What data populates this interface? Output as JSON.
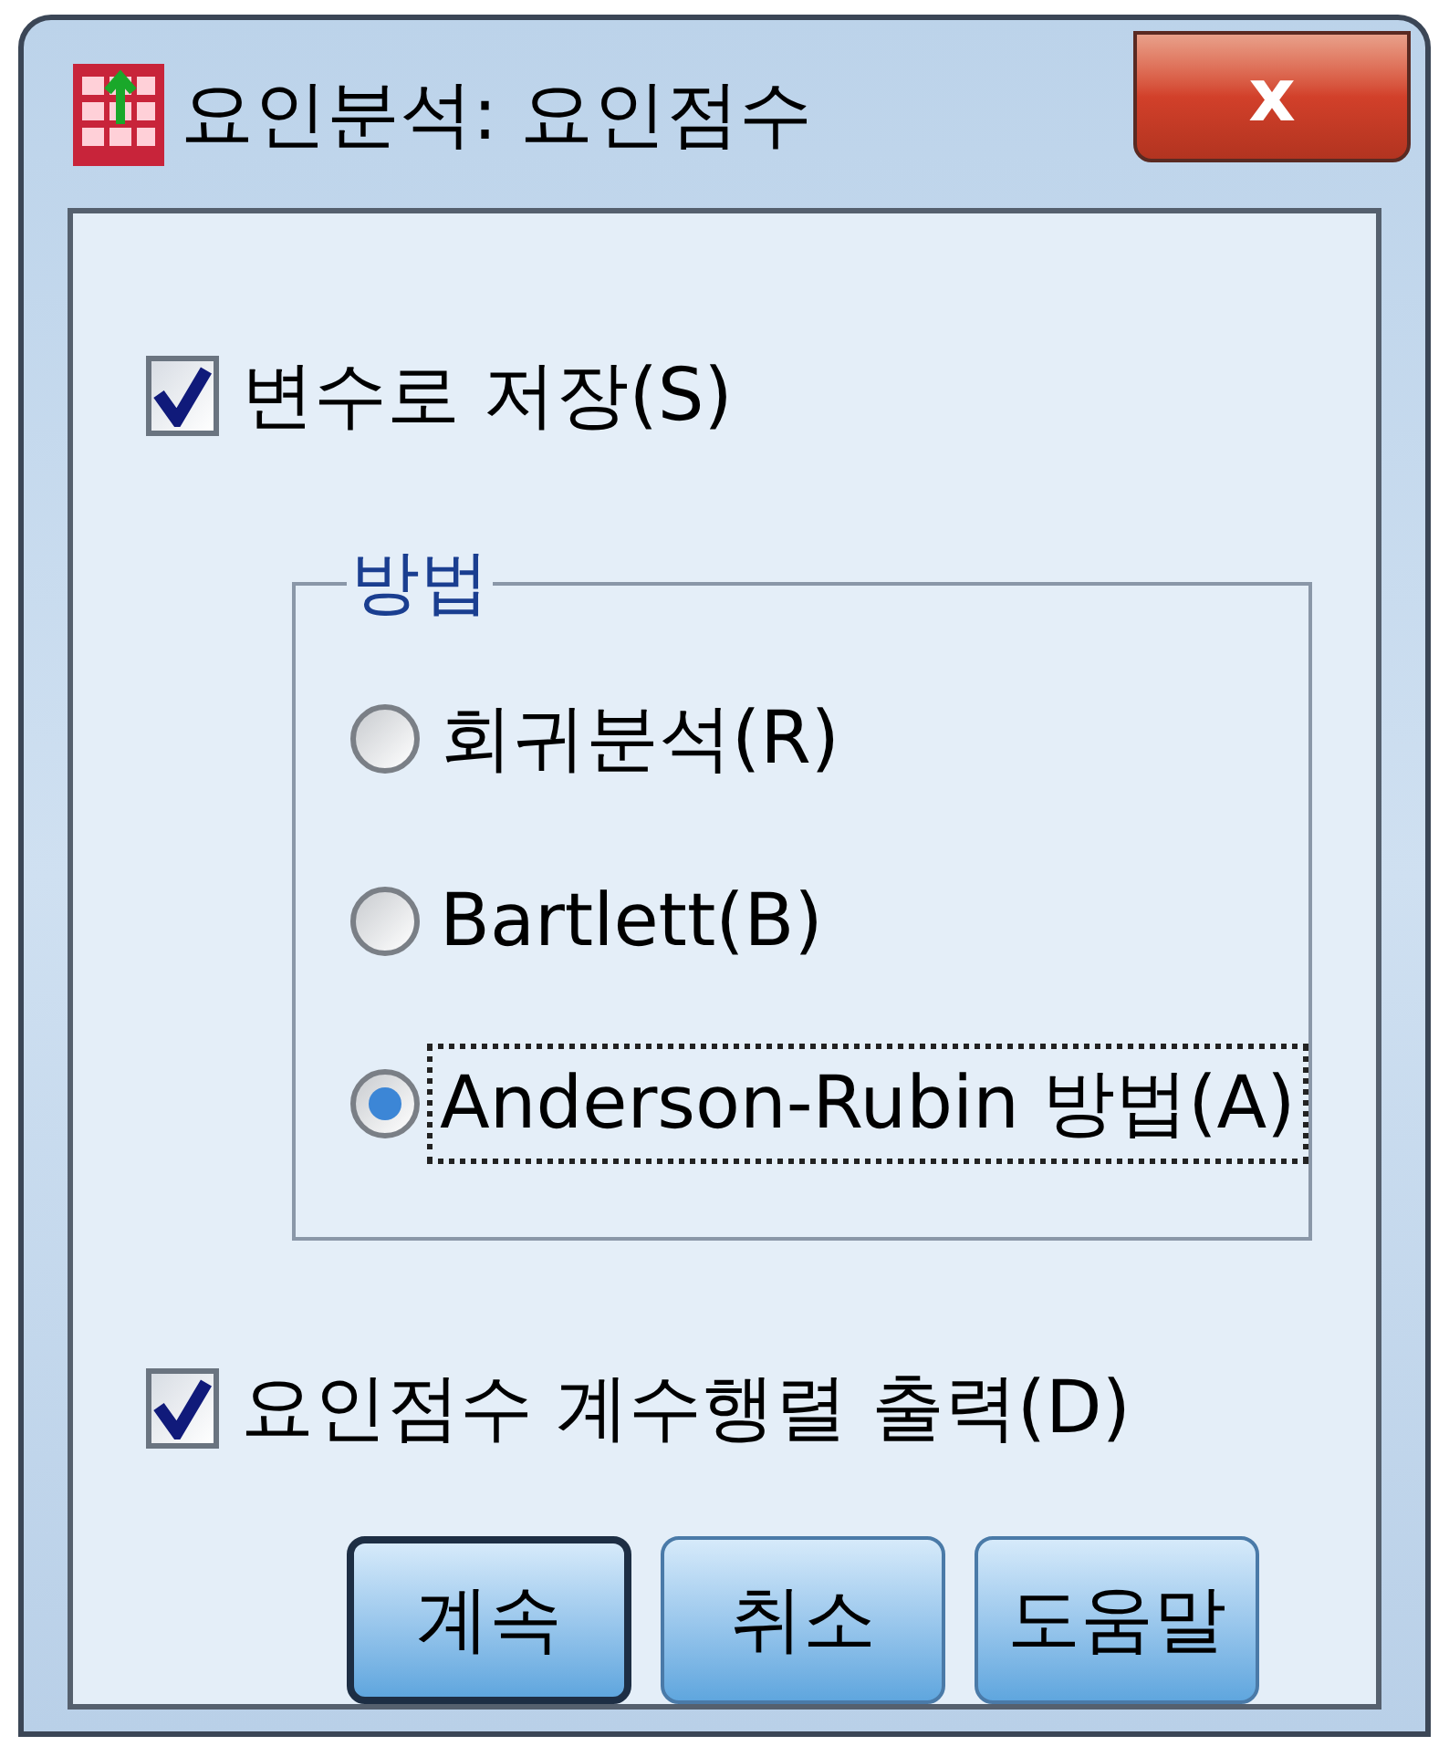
{
  "window": {
    "title": "요인분석: 요인점수",
    "close_label": "x"
  },
  "save_as_variables": {
    "label": "변수로 저장(S)",
    "checked": true
  },
  "method": {
    "legend": "방법",
    "options": [
      {
        "label": "회귀분석(R)",
        "selected": false,
        "focused": false
      },
      {
        "label": "Bartlett(B)",
        "selected": false,
        "focused": false
      },
      {
        "label": "Anderson-Rubin 방법(A)",
        "selected": true,
        "focused": true
      }
    ]
  },
  "display_matrix": {
    "label": "요인점수 계수행렬 출력(D)",
    "checked": true
  },
  "buttons": [
    {
      "label": "계속",
      "default": true
    },
    {
      "label": "취소",
      "default": false
    },
    {
      "label": "도움말",
      "default": false
    }
  ]
}
